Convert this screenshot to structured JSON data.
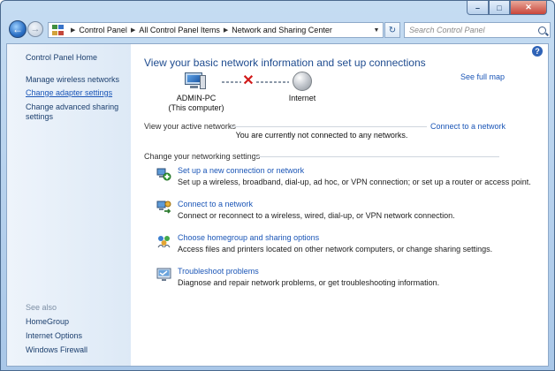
{
  "window": {
    "caption_buttons": {
      "minimize": "–",
      "maximize": "□",
      "close": "✕"
    }
  },
  "navigation": {
    "back_glyph": "←",
    "forward_glyph": "→",
    "breadcrumb": [
      "Control Panel",
      "All Control Panel Items",
      "Network and Sharing Center"
    ],
    "dropdown_glyph": "▼",
    "refresh_glyph": "↻",
    "search_placeholder": "Search Control Panel"
  },
  "sidebar": {
    "home": "Control Panel Home",
    "links": [
      "Manage wireless networks",
      "Change adapter settings",
      "Change advanced sharing settings"
    ],
    "active_index": 1,
    "see_also_label": "See also",
    "see_also": [
      "HomeGroup",
      "Internet Options",
      "Windows Firewall"
    ]
  },
  "main": {
    "help_glyph": "?",
    "heading": "View your basic network information and set up connections",
    "see_full_map": "See full map",
    "map": {
      "computer_name": "ADMIN-PC",
      "computer_sub": "(This computer)",
      "internet": "Internet",
      "status_mark": "✕"
    },
    "active_networks_label": "View your active networks",
    "connect_link": "Connect to a network",
    "not_connected": "You are currently not connected to any networks.",
    "settings_label": "Change your networking settings",
    "tasks": [
      {
        "title": "Set up a new connection or network",
        "desc": "Set up a wireless, broadband, dial-up, ad hoc, or VPN connection; or set up a router or access point.",
        "icon": "new-connection-icon"
      },
      {
        "title": "Connect to a network",
        "desc": "Connect or reconnect to a wireless, wired, dial-up, or VPN network connection.",
        "icon": "connect-network-icon"
      },
      {
        "title": "Choose homegroup and sharing options",
        "desc": "Access files and printers located on other network computers, or change sharing settings.",
        "icon": "homegroup-icon"
      },
      {
        "title": "Troubleshoot problems",
        "desc": "Diagnose and repair network problems, or get troubleshooting information.",
        "icon": "troubleshoot-icon"
      }
    ]
  }
}
